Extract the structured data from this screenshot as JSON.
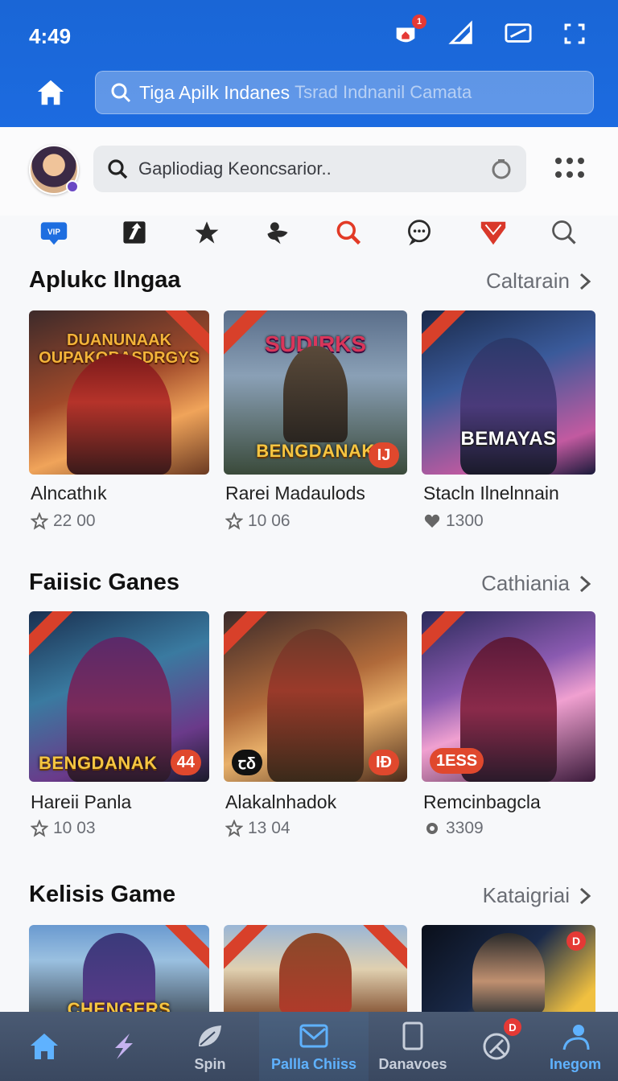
{
  "status_bar": {
    "time": "4:49",
    "notification_count": "1"
  },
  "top_search": {
    "text": "Tiga Apilk Indanes",
    "placeholder": "Tsrad Indnanil Camata"
  },
  "app_search": {
    "placeholder": "Gapliodiag Keoncsarior.."
  },
  "shortcut_icons": [
    "vip-icon",
    "share-arrow-icon",
    "star-hat-icon",
    "bird-icon",
    "search-icon",
    "chat-icon",
    "shield-icon",
    "search-icon"
  ],
  "shortcut_vip_label": "VIP",
  "sections": [
    {
      "title": "Aplukc Ilngaa",
      "link": "Caltarain",
      "cards": [
        {
          "name": "Alncathık",
          "rating": "22 00",
          "banner_top": "DUANUNAAK OUPAKOBASDRGYS",
          "banner": "",
          "pill": ""
        },
        {
          "name": "Rarei Madaulods",
          "rating": "10 06",
          "banner_top": "SUDIRKS",
          "banner": "BENGDANAK",
          "pill": "IJ"
        },
        {
          "name": "Stacln Ilnelnnain",
          "rating": "1300",
          "banner_top": "",
          "banner": "BEMAYAS",
          "pill": ""
        }
      ]
    },
    {
      "title": "Faiisic Ganes",
      "link": "Cathiania",
      "cards": [
        {
          "name": "Hareii Panla",
          "rating": "10 03",
          "banner_top": "",
          "banner": "BENGDANAK",
          "pill": "44"
        },
        {
          "name": "Alakalnhadok",
          "rating": "13 04",
          "banner_top": "",
          "banner": "",
          "pill": "IĐ",
          "pill_left": "ꞇδ"
        },
        {
          "name": "Remcinbagcla",
          "rating": "3309",
          "banner_top": "",
          "banner": "",
          "pill": "",
          "pill_left": "1ESS"
        }
      ]
    },
    {
      "title": "Kelisis Game",
      "link": "Kataigriai",
      "cards": [
        {
          "name": "",
          "rating": "",
          "banner_top": "",
          "banner": "CHENGERS",
          "pill": ""
        },
        {
          "name": "",
          "rating": "",
          "banner_top": "",
          "banner": "",
          "pill": ""
        },
        {
          "name": "",
          "rating": "",
          "banner_top": "",
          "banner": "",
          "pill": "",
          "badge": "D"
        }
      ]
    }
  ],
  "bottom_nav": [
    {
      "label": "",
      "icon": "home-icon",
      "active": true
    },
    {
      "label": "",
      "icon": "bolt-icon"
    },
    {
      "label": "Spin",
      "icon": "leaf-icon"
    },
    {
      "label": "Pallla Chiiss",
      "icon": "inbox-icon",
      "active": true
    },
    {
      "label": "Danavoes",
      "icon": "tablet-icon"
    },
    {
      "label": "",
      "icon": "radar-icon",
      "badge": "D"
    },
    {
      "label": "Inegom",
      "icon": "profile-icon"
    }
  ],
  "colors": {
    "primary": "#1c6be0",
    "accent_red": "#d8402a",
    "nav_bg": "#3a4860",
    "nav_active": "#5fb2ff"
  }
}
